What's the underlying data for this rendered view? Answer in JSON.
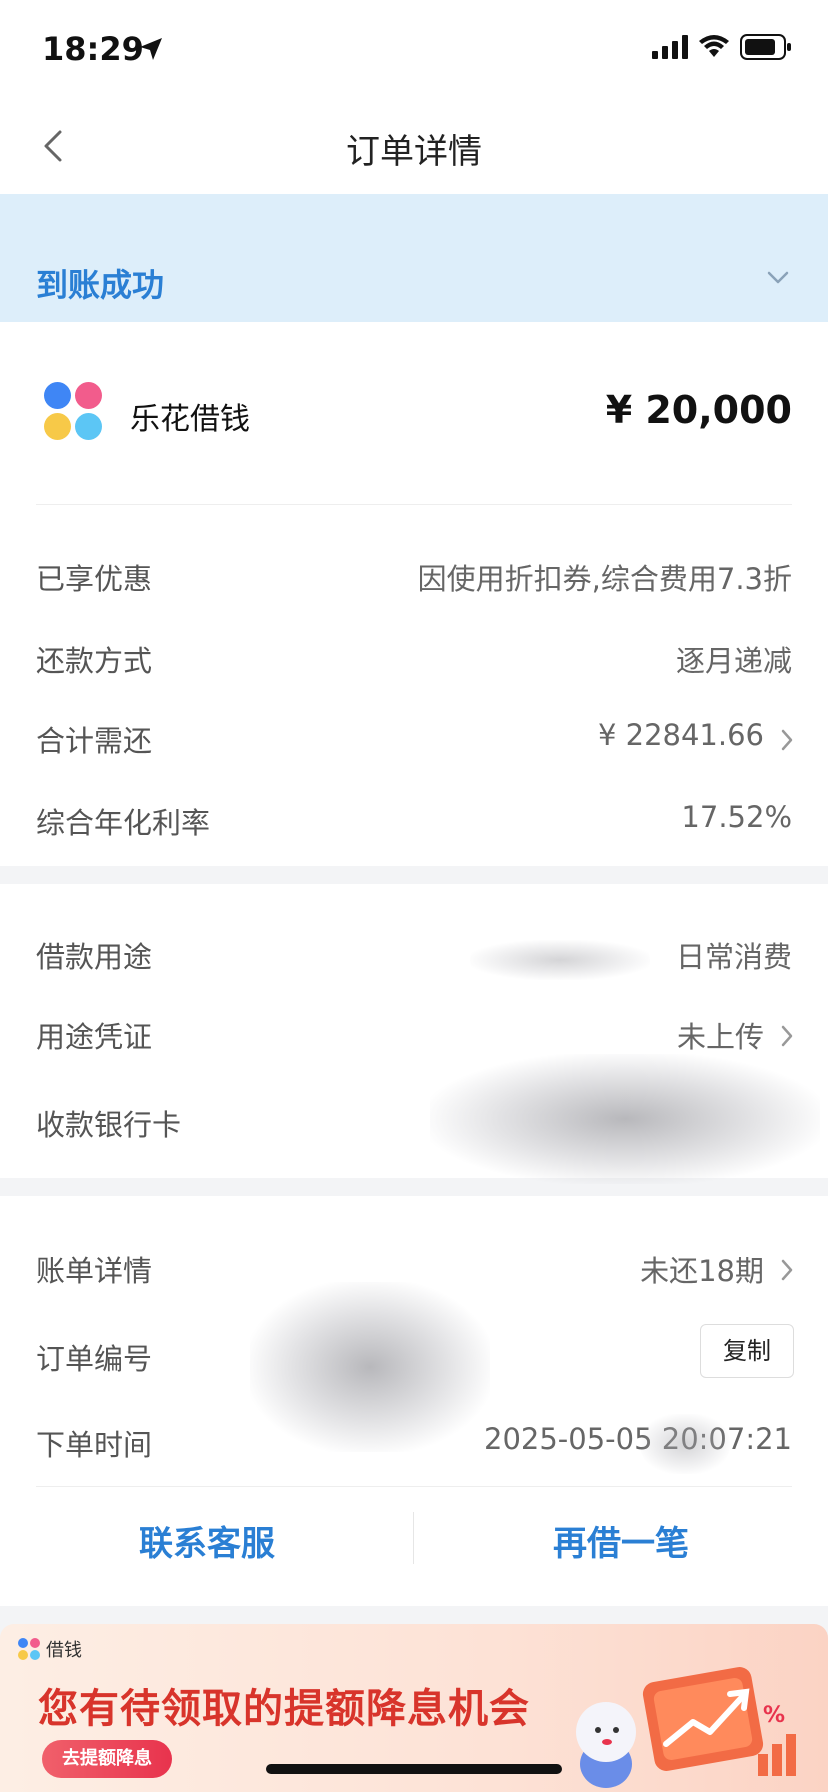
{
  "status_bar": {
    "time": "18:29"
  },
  "nav": {
    "title": "订单详情"
  },
  "banner": {
    "status": "到账成功"
  },
  "product": {
    "name": "乐花借钱",
    "amount": "¥ 20,000"
  },
  "loan_details": [
    {
      "label": "已享优惠",
      "value": "因使用折扣券,综合费用7.3折"
    },
    {
      "label": "还款方式",
      "value": "逐月递减"
    },
    {
      "label": "合计需还",
      "value": "¥ 22841.66"
    },
    {
      "label": "综合年化利率",
      "value": "17.52%"
    }
  ],
  "purpose_details": [
    {
      "label": "借款用途",
      "value": "日常消费"
    },
    {
      "label": "用途凭证",
      "value": "未上传"
    },
    {
      "label": "收款银行卡",
      "value": ""
    }
  ],
  "order_details": [
    {
      "label": "账单详情",
      "value": "未还18期"
    },
    {
      "label": "订单编号",
      "value": ""
    },
    {
      "label": "下单时间",
      "value": "2025-05-05 20:07:21"
    }
  ],
  "copy_label": "复制",
  "actions": {
    "contact": "联系客服",
    "borrow_again": "再借一笔"
  },
  "promo": {
    "brand": "借钱",
    "title": "您有待领取的提额降息机会",
    "button": "去提额降息"
  },
  "colors": {
    "accent": "#2a7fd4",
    "banner_bg": "#ddeefa",
    "promo_red": "#d8342b"
  },
  "icons": [
    "back-chevron-icon",
    "location-arrow-icon",
    "signal-icon",
    "wifi-icon",
    "battery-icon",
    "chevron-down-icon",
    "chevron-right-icon"
  ]
}
